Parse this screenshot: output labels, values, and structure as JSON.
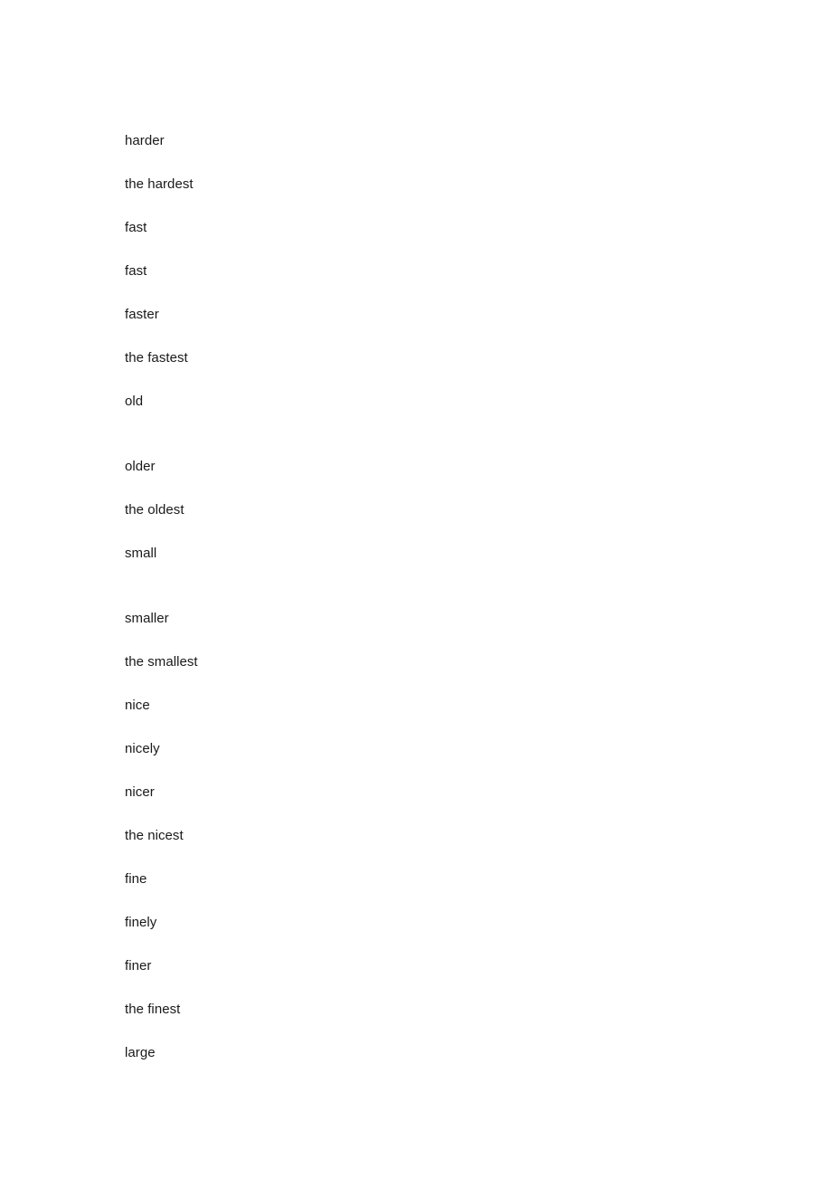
{
  "document": {
    "page_background": "#ffffff",
    "text_color": "#1a1a1a",
    "lines": [
      {
        "text": "harder",
        "extra_gap": false
      },
      {
        "text": "the hardest",
        "extra_gap": false
      },
      {
        "text": "fast",
        "extra_gap": false
      },
      {
        "text": "fast",
        "extra_gap": false
      },
      {
        "text": "faster",
        "extra_gap": false
      },
      {
        "text": "the fastest",
        "extra_gap": false
      },
      {
        "text": "old",
        "extra_gap": true
      },
      {
        "text": "older",
        "extra_gap": false
      },
      {
        "text": "the oldest",
        "extra_gap": false
      },
      {
        "text": "small",
        "extra_gap": true
      },
      {
        "text": "smaller",
        "extra_gap": false
      },
      {
        "text": "the smallest",
        "extra_gap": false
      },
      {
        "text": "nice",
        "extra_gap": false
      },
      {
        "text": "nicely",
        "extra_gap": false
      },
      {
        "text": "nicer",
        "extra_gap": false
      },
      {
        "text": "the nicest",
        "extra_gap": false
      },
      {
        "text": "fine",
        "extra_gap": false
      },
      {
        "text": "finely",
        "extra_gap": false
      },
      {
        "text": "finer",
        "extra_gap": false
      },
      {
        "text": "the finest",
        "extra_gap": false
      },
      {
        "text": "large",
        "extra_gap": false
      }
    ]
  }
}
